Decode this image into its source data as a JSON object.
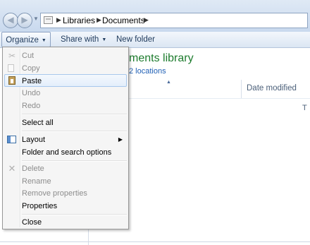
{
  "address": {
    "crumbs": [
      "Libraries",
      "Documents"
    ],
    "separator": "▶"
  },
  "toolbar": {
    "organize_label": "Organize",
    "share_label": "Share with",
    "newfolder_label": "New folder"
  },
  "library": {
    "title_partial": "ments library",
    "locations_partial": "2 locations",
    "column_date": "Date modified",
    "cut_off_text": "T"
  },
  "organize_menu": {
    "items": [
      {
        "label": "Cut",
        "enabled": false,
        "icon": "scissors-icon"
      },
      {
        "label": "Copy",
        "enabled": false,
        "icon": "copy-icon"
      },
      {
        "label": "Paste",
        "enabled": true,
        "icon": "paste-icon",
        "highlighted": true
      },
      {
        "label": "Undo",
        "enabled": false
      },
      {
        "label": "Redo",
        "enabled": false
      },
      {
        "label": "Select all",
        "enabled": true
      },
      {
        "label": "Layout",
        "enabled": true,
        "icon": "layout-icon",
        "submenu": true
      },
      {
        "label": "Folder and search options",
        "enabled": true
      },
      {
        "label": "Delete",
        "enabled": false,
        "icon": "delete-x-icon"
      },
      {
        "label": "Rename",
        "enabled": false
      },
      {
        "label": "Remove properties",
        "enabled": false
      },
      {
        "label": "Properties",
        "enabled": true
      },
      {
        "label": "Close",
        "enabled": true
      }
    ]
  },
  "colors": {
    "accent_green": "#1e7c2e",
    "link_blue": "#1f5fb5",
    "toolbar_text": "#1e395b",
    "disabled_text": "#8d8d8d",
    "highlight_border": "#a8c8ec"
  }
}
